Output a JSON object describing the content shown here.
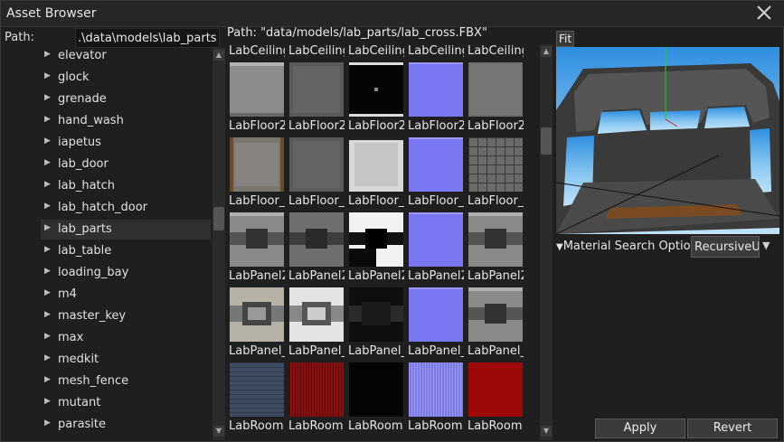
{
  "window": {
    "title": "Asset Browser"
  },
  "left": {
    "path_label": "Path:",
    "path_value": ".\\data\\models\\lab_parts",
    "tree_items": [
      {
        "label": "elevator",
        "selected": false
      },
      {
        "label": "glock",
        "selected": false
      },
      {
        "label": "grenade",
        "selected": false
      },
      {
        "label": "hand_wash",
        "selected": false
      },
      {
        "label": "iapetus",
        "selected": false
      },
      {
        "label": "lab_door",
        "selected": false
      },
      {
        "label": "lab_hatch",
        "selected": false
      },
      {
        "label": "lab_hatch_door",
        "selected": false
      },
      {
        "label": "lab_parts",
        "selected": true
      },
      {
        "label": "lab_table",
        "selected": false
      },
      {
        "label": "loading_bay",
        "selected": false
      },
      {
        "label": "m4",
        "selected": false
      },
      {
        "label": "master_key",
        "selected": false
      },
      {
        "label": "max",
        "selected": false
      },
      {
        "label": "medkit",
        "selected": false
      },
      {
        "label": "mesh_fence",
        "selected": false
      },
      {
        "label": "mutant",
        "selected": false
      },
      {
        "label": "parasite",
        "selected": false
      }
    ]
  },
  "grid": {
    "path_text": "Path: \"data/models/lab_parts/lab_cross.FBX\"",
    "rows": [
      {
        "labels": [
          "LabCeiling",
          "LabCeiling",
          "LabCeiling",
          "LabCeiling",
          "LabCeiling"
        ],
        "textures": [
          "gray-light",
          "gray-dark",
          "black-dot",
          "normal-blue",
          "gray-mid"
        ]
      },
      {
        "labels": [
          "LabFloor2",
          "LabFloor2",
          "LabFloor2",
          "LabFloor2",
          "LabFloor2"
        ],
        "textures": [
          "gray-rust",
          "gray-dark",
          "white-mottled",
          "normal-blue",
          "grid-panel"
        ]
      },
      {
        "labels": [
          "LabFloor_",
          "LabFloor_",
          "LabFloor_",
          "LabFloor_",
          "LabFloor_"
        ],
        "textures": [
          "panel-gray",
          "panel-dark",
          "panel-bw",
          "normal-blue",
          "panel-gray"
        ]
      },
      {
        "labels": [
          "LabPanel2",
          "LabPanel2",
          "LabPanel2",
          "LabPanel2",
          "LabPanel2"
        ],
        "textures": [
          "panel-light",
          "panel-bright",
          "panel-black",
          "normal-blue",
          "panel-gray"
        ]
      },
      {
        "labels": [
          "LabPanel_",
          "LabPanel_",
          "LabPanel_",
          "LabPanel_",
          "LabPanel_"
        ],
        "textures": [
          "denim",
          "red-mesh",
          "black",
          "normal-stripe",
          "red"
        ]
      }
    ],
    "bottom_labels": [
      "LabRoom",
      "LabRoom",
      "LabRoom",
      "LabRoom",
      "LabRoom"
    ]
  },
  "preview": {
    "fit_label": "Fit",
    "material_label": "Material Search Optio",
    "material_value": "RecursiveU",
    "apply_label": "Apply",
    "revert_label": "Revert"
  },
  "colors": {
    "normal_blue": "#7b76f2",
    "selection": "#303030",
    "sky": "#6fb6ea"
  }
}
